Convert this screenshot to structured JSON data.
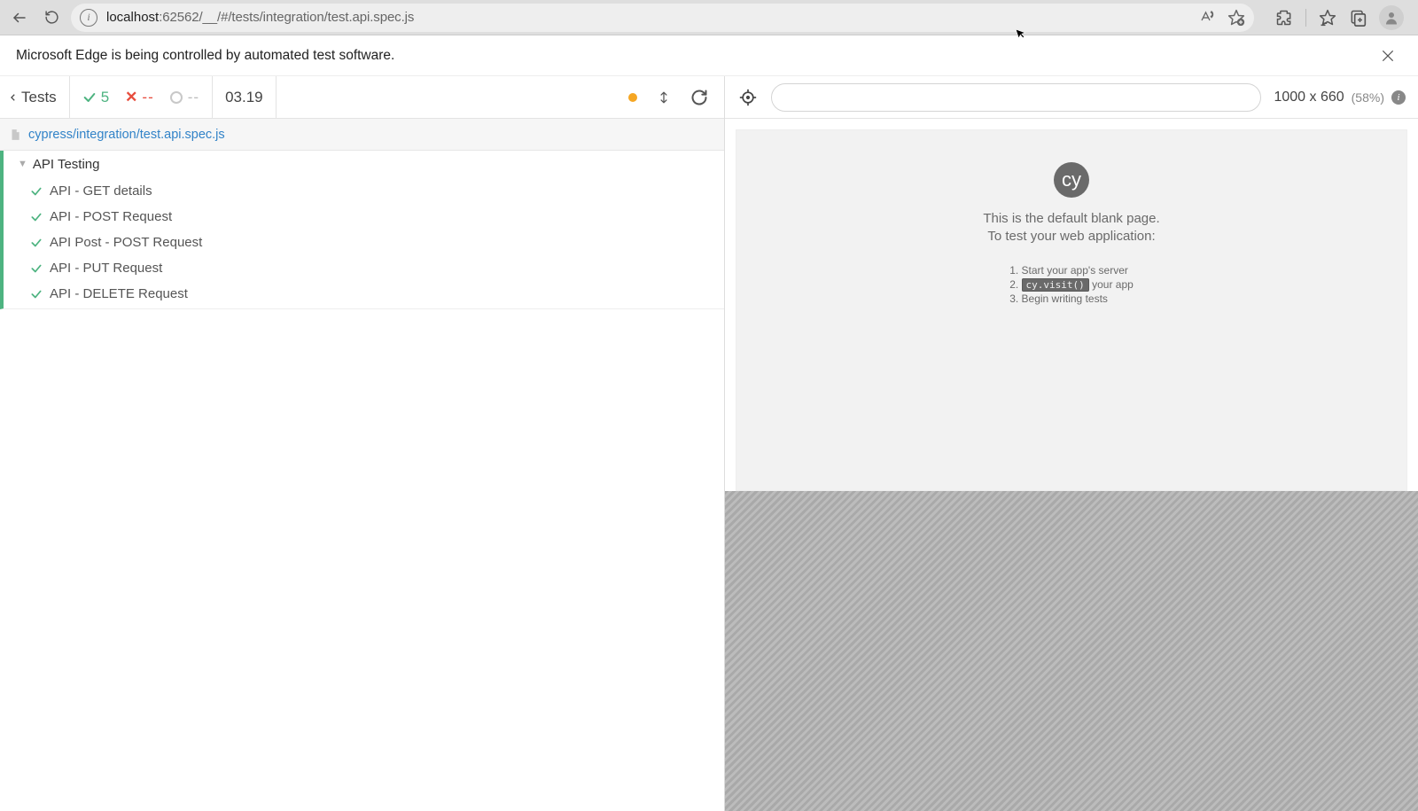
{
  "browser": {
    "url_host": "localhost",
    "url_rest": ":62562/__/#/tests/integration/test.api.spec.js"
  },
  "automation": {
    "message": "Microsoft Edge is being controlled by automated test software."
  },
  "runner_toolbar": {
    "back_label": "Tests",
    "passed": "5",
    "failed": "--",
    "pending": "--",
    "duration": "03.19"
  },
  "viewport": {
    "dimensions": "1000 x 660",
    "scale": "(58%)"
  },
  "spec": {
    "path": "cypress/integration/test.api.spec.js"
  },
  "tests": {
    "suite": "API Testing",
    "items": [
      "API - GET details",
      "API - POST Request",
      "API Post - POST Request",
      "API - PUT Request",
      "API - DELETE Request"
    ]
  },
  "aut": {
    "logo": "cy",
    "line1": "This is the default blank page.",
    "line2": "To test your web application:",
    "steps": {
      "s1": "Start your app's server",
      "s2_code": "cy.visit()",
      "s2_rest": " your app",
      "s3": "Begin writing tests"
    }
  }
}
